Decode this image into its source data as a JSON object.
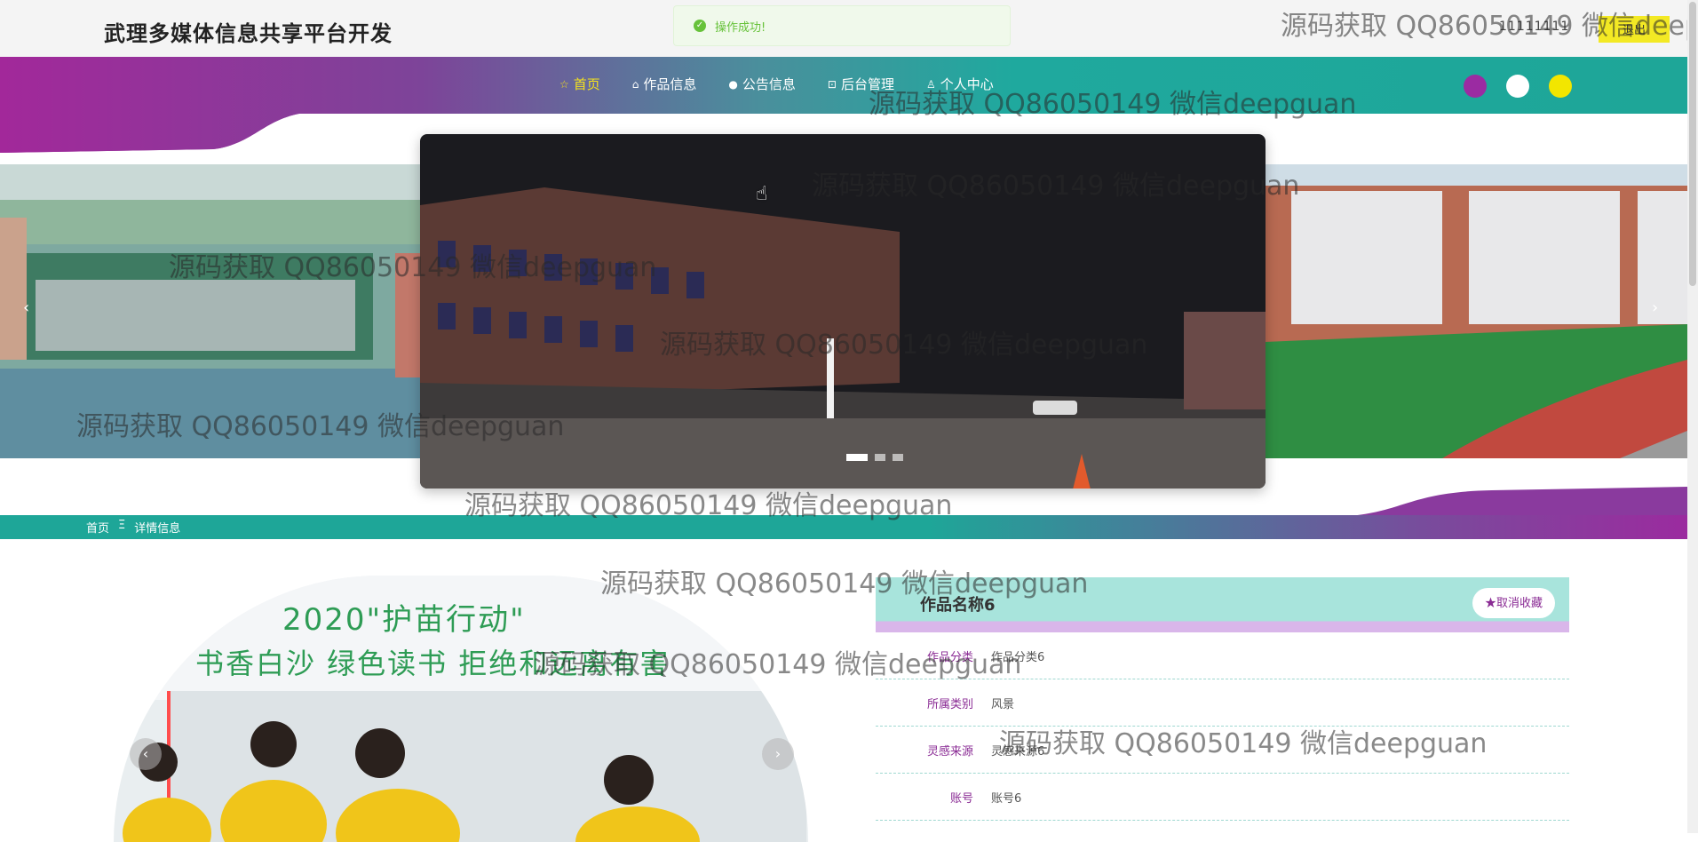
{
  "header": {
    "site_title": "武理多媒体信息共享平台开发",
    "toast": "操作成功!",
    "username": "11111111",
    "logout": "退出"
  },
  "nav": {
    "items": [
      {
        "label": "首页",
        "icon": "star-icon",
        "active": true
      },
      {
        "label": "作品信息",
        "icon": "bag-icon"
      },
      {
        "label": "公告信息",
        "icon": "info-icon"
      },
      {
        "label": "后台管理",
        "icon": "box-icon"
      },
      {
        "label": "个人中心",
        "icon": "user-icon"
      }
    ],
    "theme_colors": [
      "#9b2ba2",
      "#ffffff",
      "#f2e600"
    ]
  },
  "carousel": {
    "prev": "‹",
    "next": "›",
    "slides": 3,
    "active": 1
  },
  "breadcrumb": {
    "home": "首页",
    "separator": "Ξ",
    "current": "详情信息"
  },
  "detail": {
    "title": "作品名称6",
    "favorite_button": "取消收藏",
    "fields": [
      {
        "label": "作品分类",
        "value": "作品分类6"
      },
      {
        "label": "所属类别",
        "value": "风景"
      },
      {
        "label": "灵感来源",
        "value": "灵感来源6"
      },
      {
        "label": "账号",
        "value": "账号6"
      }
    ]
  },
  "watermark": "源码获取 QQ86050149 微信deepguan"
}
